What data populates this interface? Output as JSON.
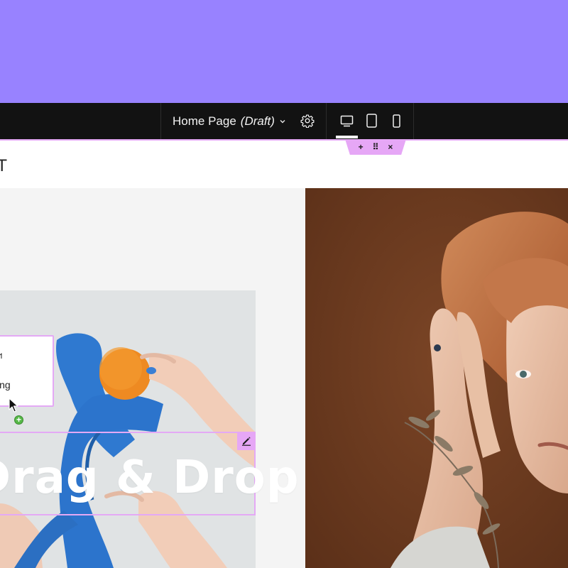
{
  "colors": {
    "top_band": "#9882ff",
    "toolbar": "#121212",
    "selection": "#e4a9f5",
    "section_tab": "#e6a7f6",
    "add_dot": "#56b847"
  },
  "toolbar": {
    "page_name": "Home Page",
    "page_status": "(Draft)",
    "icons": {
      "page_caret": "chevron-down-icon",
      "settings": "gear-icon",
      "desktop": "desktop-icon",
      "tablet": "tablet-icon",
      "mobile": "mobile-icon"
    },
    "active_device": "desktop"
  },
  "section_controls": {
    "add": "+",
    "drag": "⠿",
    "close": "×"
  },
  "header": {
    "logo_fragment": "T"
  },
  "dropdown": {
    "items": [
      "ฯ",
      "ing"
    ]
  },
  "heading": {
    "text": "Drag & Drop"
  }
}
